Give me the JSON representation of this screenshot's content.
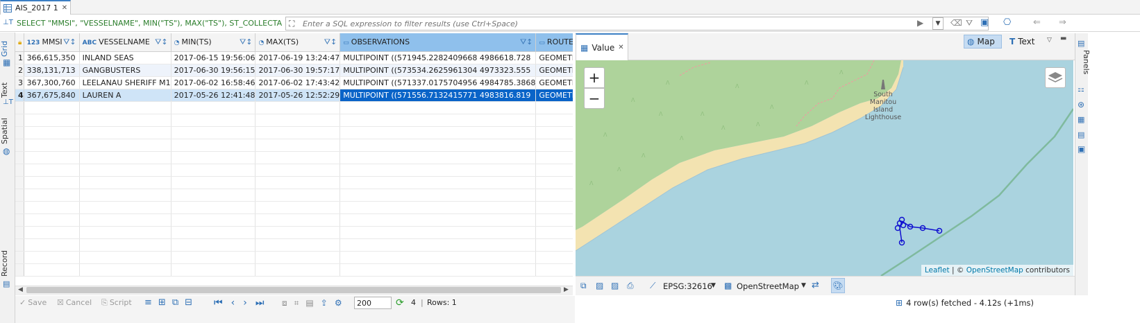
{
  "tab": {
    "title": "AIS_2017 1"
  },
  "sql": {
    "query": "SELECT \"MMSI\", \"VESSELNAME\", MIN(\"TS\"), MAX(\"TS\"), ST_COLLECTAGG",
    "filter_placeholder": "Enter a SQL expression to filter results (use Ctrl+Space)"
  },
  "side_tabs": {
    "grid": "Grid",
    "text": "Text",
    "spatial": "Spatial",
    "record": "Record"
  },
  "grid": {
    "columns": [
      {
        "type_icon": "123",
        "name": "MMSI"
      },
      {
        "type_icon": "ABC",
        "name": "VESSELNAME"
      },
      {
        "type_icon": "clock",
        "name": "MIN(TS)"
      },
      {
        "type_icon": "clock",
        "name": "MAX(TS)"
      },
      {
        "type_icon": "geom",
        "name": "OBSERVATIONS"
      },
      {
        "type_icon": "geom",
        "name": "ROUTE"
      }
    ],
    "rows": [
      {
        "n": "1",
        "mmsi": "366,615,350",
        "vessel": "INLAND SEAS",
        "min": "2017-06-15 19:56:06",
        "max": "2017-06-19 13:24:47",
        "obs": "MULTIPOINT ((571945.2282409668 4986618.728",
        "route": "GEOMETRYCOLLEC"
      },
      {
        "n": "2",
        "mmsi": "338,131,713",
        "vessel": "GANGBUSTERS",
        "min": "2017-06-30 19:56:15",
        "max": "2017-06-30 19:57:17",
        "obs": "MULTIPOINT ((573534.2625961304 4973323.555",
        "route": "GEOMETRYCOLLEC"
      },
      {
        "n": "3",
        "mmsi": "367,300,760",
        "vessel": "LEELANAU SHERIFF M1",
        "min": "2017-06-02 16:58:46",
        "max": "2017-06-02 17:43:42",
        "obs": "MULTIPOINT ((571337.0175704956 4984785.3868",
        "route": "GEOMETRYCOLLEC"
      },
      {
        "n": "4",
        "mmsi": "367,675,840",
        "vessel": "LAUREN A",
        "min": "2017-05-26 12:41:48",
        "max": "2017-05-26 12:52:29",
        "obs": "MULTIPOINT ((571556.7132415771 4983816.819",
        "route": "GEOMETRYCOLLEC"
      }
    ]
  },
  "bottom_toolbar": {
    "save": "Save",
    "cancel": "Cancel",
    "script": "Script",
    "fetch_size": "200",
    "row_count": "4",
    "rows_label": "Rows: 1"
  },
  "value_panel": {
    "tab": "Value",
    "map_btn": "Map",
    "text_btn": "Text",
    "map": {
      "zoom_in": "+",
      "zoom_out": "−",
      "place_label_1": "South",
      "place_label_2": "Manitou",
      "place_label_3": "Island",
      "place_label_4": "Lighthouse",
      "attrib_leaflet": "Leaflet",
      "attrib_sep": " | © ",
      "attrib_osm": "OpenStreetMap",
      "attrib_tail": " contributors"
    },
    "crs": "EPSG:32616",
    "basemap": "OpenStreetMap"
  },
  "right_panel": {
    "label": "Panels"
  },
  "status": {
    "text": "4 row(s) fetched - 4.12s (+1ms)"
  },
  "colors": {
    "accent": "#3c7fc4",
    "selected_cell": "#0a64c8",
    "map_water": "#aad3df",
    "map_land": "#aed39b",
    "route": "#1010d0"
  }
}
